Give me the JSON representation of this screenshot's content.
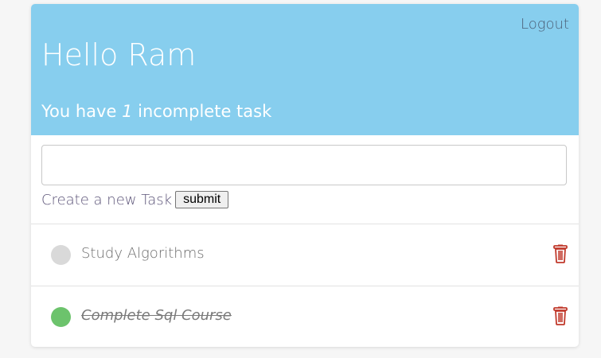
{
  "header": {
    "logout_label": "Logout",
    "greeting": "Hello Ram",
    "summary_prefix": "You have ",
    "incomplete_count": "1",
    "summary_suffix": " incomplete task"
  },
  "create": {
    "input_value": "",
    "label": "Create a new Task",
    "submit_label": "submit"
  },
  "tasks": [
    {
      "title": "Study Algorithms",
      "completed": false
    },
    {
      "title": "Complete Sql Course",
      "completed": true
    }
  ],
  "colors": {
    "header_bg": "#87ceee",
    "incomplete_dot": "#d9d9d9",
    "complete_dot": "#6cc36c",
    "trash": "#c0392b"
  },
  "icons": {
    "delete": "trash-icon",
    "status": "circle-status-icon"
  }
}
